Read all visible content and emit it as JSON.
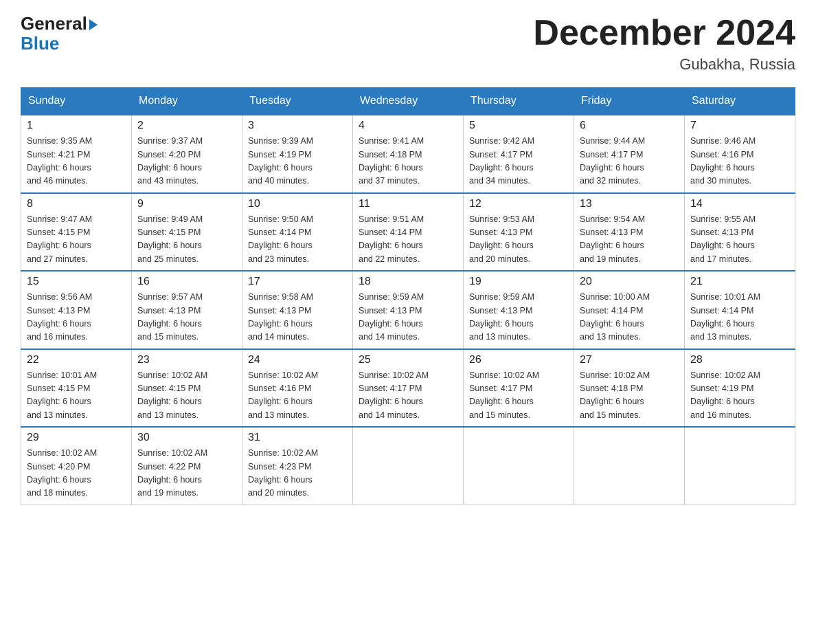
{
  "header": {
    "logo_general": "General",
    "logo_blue": "Blue",
    "title": "December 2024",
    "subtitle": "Gubakha, Russia"
  },
  "days_of_week": [
    "Sunday",
    "Monday",
    "Tuesday",
    "Wednesday",
    "Thursday",
    "Friday",
    "Saturday"
  ],
  "weeks": [
    [
      {
        "day": "1",
        "sunrise": "9:35 AM",
        "sunset": "4:21 PM",
        "daylight": "6 hours and 46 minutes."
      },
      {
        "day": "2",
        "sunrise": "9:37 AM",
        "sunset": "4:20 PM",
        "daylight": "6 hours and 43 minutes."
      },
      {
        "day": "3",
        "sunrise": "9:39 AM",
        "sunset": "4:19 PM",
        "daylight": "6 hours and 40 minutes."
      },
      {
        "day": "4",
        "sunrise": "9:41 AM",
        "sunset": "4:18 PM",
        "daylight": "6 hours and 37 minutes."
      },
      {
        "day": "5",
        "sunrise": "9:42 AM",
        "sunset": "4:17 PM",
        "daylight": "6 hours and 34 minutes."
      },
      {
        "day": "6",
        "sunrise": "9:44 AM",
        "sunset": "4:17 PM",
        "daylight": "6 hours and 32 minutes."
      },
      {
        "day": "7",
        "sunrise": "9:46 AM",
        "sunset": "4:16 PM",
        "daylight": "6 hours and 30 minutes."
      }
    ],
    [
      {
        "day": "8",
        "sunrise": "9:47 AM",
        "sunset": "4:15 PM",
        "daylight": "6 hours and 27 minutes."
      },
      {
        "day": "9",
        "sunrise": "9:49 AM",
        "sunset": "4:15 PM",
        "daylight": "6 hours and 25 minutes."
      },
      {
        "day": "10",
        "sunrise": "9:50 AM",
        "sunset": "4:14 PM",
        "daylight": "6 hours and 23 minutes."
      },
      {
        "day": "11",
        "sunrise": "9:51 AM",
        "sunset": "4:14 PM",
        "daylight": "6 hours and 22 minutes."
      },
      {
        "day": "12",
        "sunrise": "9:53 AM",
        "sunset": "4:13 PM",
        "daylight": "6 hours and 20 minutes."
      },
      {
        "day": "13",
        "sunrise": "9:54 AM",
        "sunset": "4:13 PM",
        "daylight": "6 hours and 19 minutes."
      },
      {
        "day": "14",
        "sunrise": "9:55 AM",
        "sunset": "4:13 PM",
        "daylight": "6 hours and 17 minutes."
      }
    ],
    [
      {
        "day": "15",
        "sunrise": "9:56 AM",
        "sunset": "4:13 PM",
        "daylight": "6 hours and 16 minutes."
      },
      {
        "day": "16",
        "sunrise": "9:57 AM",
        "sunset": "4:13 PM",
        "daylight": "6 hours and 15 minutes."
      },
      {
        "day": "17",
        "sunrise": "9:58 AM",
        "sunset": "4:13 PM",
        "daylight": "6 hours and 14 minutes."
      },
      {
        "day": "18",
        "sunrise": "9:59 AM",
        "sunset": "4:13 PM",
        "daylight": "6 hours and 14 minutes."
      },
      {
        "day": "19",
        "sunrise": "9:59 AM",
        "sunset": "4:13 PM",
        "daylight": "6 hours and 13 minutes."
      },
      {
        "day": "20",
        "sunrise": "10:00 AM",
        "sunset": "4:14 PM",
        "daylight": "6 hours and 13 minutes."
      },
      {
        "day": "21",
        "sunrise": "10:01 AM",
        "sunset": "4:14 PM",
        "daylight": "6 hours and 13 minutes."
      }
    ],
    [
      {
        "day": "22",
        "sunrise": "10:01 AM",
        "sunset": "4:15 PM",
        "daylight": "6 hours and 13 minutes."
      },
      {
        "day": "23",
        "sunrise": "10:02 AM",
        "sunset": "4:15 PM",
        "daylight": "6 hours and 13 minutes."
      },
      {
        "day": "24",
        "sunrise": "10:02 AM",
        "sunset": "4:16 PM",
        "daylight": "6 hours and 13 minutes."
      },
      {
        "day": "25",
        "sunrise": "10:02 AM",
        "sunset": "4:17 PM",
        "daylight": "6 hours and 14 minutes."
      },
      {
        "day": "26",
        "sunrise": "10:02 AM",
        "sunset": "4:17 PM",
        "daylight": "6 hours and 15 minutes."
      },
      {
        "day": "27",
        "sunrise": "10:02 AM",
        "sunset": "4:18 PM",
        "daylight": "6 hours and 15 minutes."
      },
      {
        "day": "28",
        "sunrise": "10:02 AM",
        "sunset": "4:19 PM",
        "daylight": "6 hours and 16 minutes."
      }
    ],
    [
      {
        "day": "29",
        "sunrise": "10:02 AM",
        "sunset": "4:20 PM",
        "daylight": "6 hours and 18 minutes."
      },
      {
        "day": "30",
        "sunrise": "10:02 AM",
        "sunset": "4:22 PM",
        "daylight": "6 hours and 19 minutes."
      },
      {
        "day": "31",
        "sunrise": "10:02 AM",
        "sunset": "4:23 PM",
        "daylight": "6 hours and 20 minutes."
      },
      null,
      null,
      null,
      null
    ]
  ],
  "labels": {
    "sunrise": "Sunrise:",
    "sunset": "Sunset:",
    "daylight": "Daylight:"
  }
}
